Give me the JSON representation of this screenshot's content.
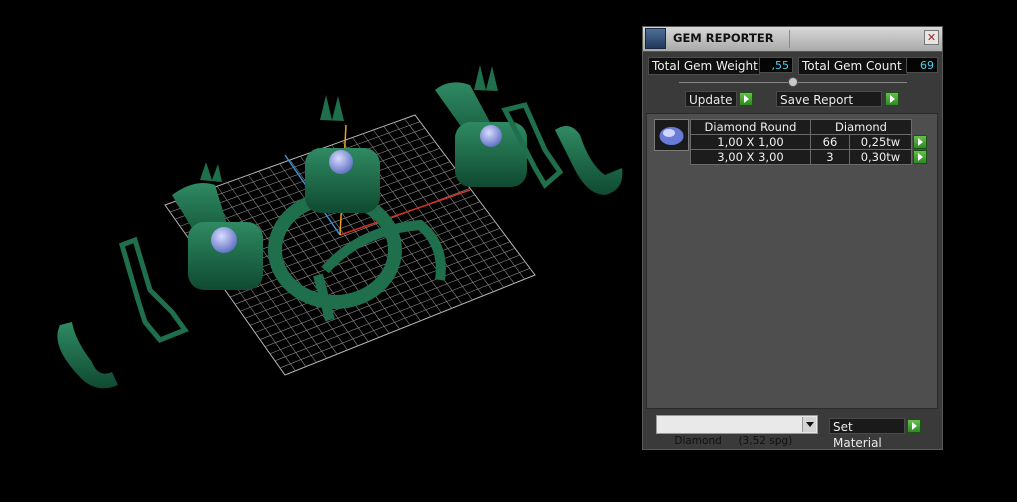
{
  "viewport": {
    "label": ""
  },
  "panel": {
    "title": "GEM REPORTER",
    "close_glyph": "✕",
    "total_weight_label": "Total Gem Weight",
    "total_weight_value": ",55",
    "total_count_label": "Total Gem Count",
    "total_count_value": "69",
    "update_label": "Update",
    "save_report_label": "Save Report",
    "report": {
      "gem_icon": "round-diamond-icon",
      "headers": [
        "Diamond Round",
        "Diamond"
      ],
      "rows": [
        {
          "size": "1,00 X 1,00",
          "count": "66",
          "weight": "0,25tw"
        },
        {
          "size": "3,00 X 3,00",
          "count": "3",
          "weight": "0,30tw"
        }
      ]
    },
    "material_select": "Diamond     (3,52 spg)",
    "set_material_label": "Set Material",
    "colors": {
      "value_text": "#4fd2e8",
      "button_green": "#3fa52f",
      "model_green": "#1f6e4c"
    }
  }
}
